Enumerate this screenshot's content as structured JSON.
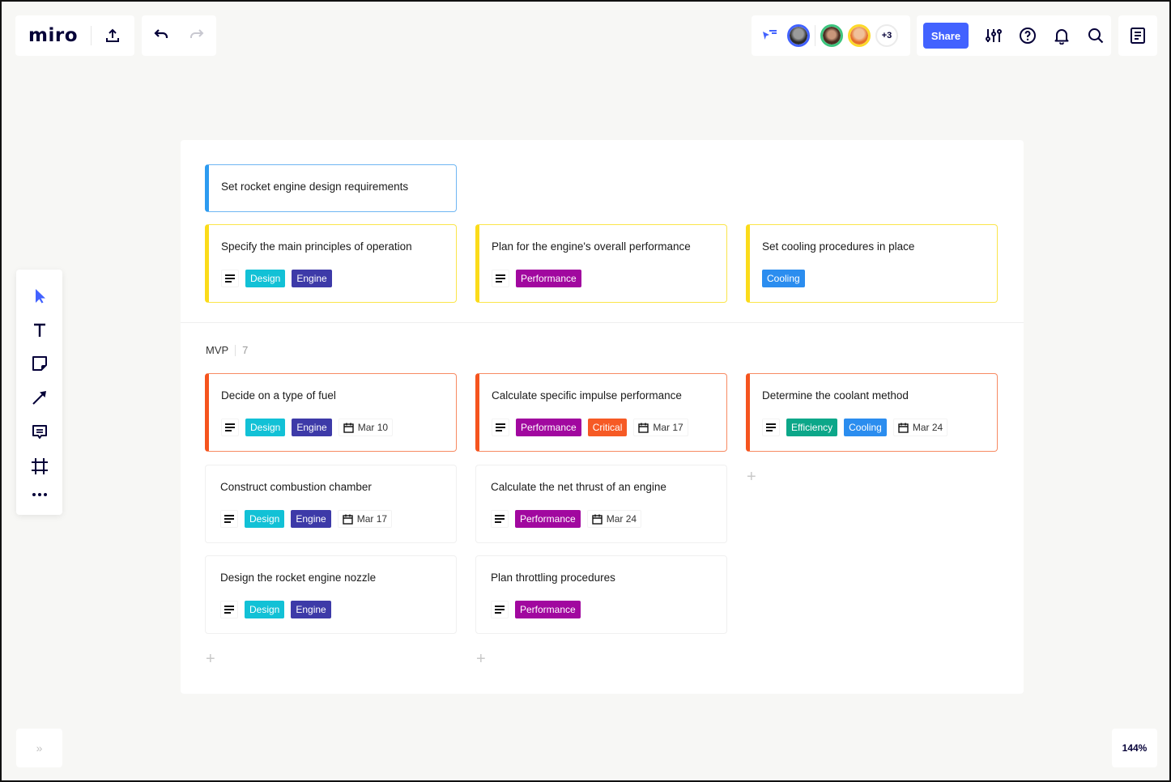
{
  "app": {
    "logo": "miro",
    "zoom_level": "144%",
    "collapse_label": "»"
  },
  "header": {
    "share_label": "Share",
    "collaborators_more": "+3",
    "collaborators": [
      {
        "name": "collaborator-1",
        "ring": "#4262ff",
        "skin": "#6b6b6b"
      },
      {
        "name": "collaborator-2",
        "ring": "#3dc47e",
        "skin": "#8a5a44"
      },
      {
        "name": "collaborator-3",
        "ring": "#fcd92a",
        "skin": "#e0a37a"
      }
    ]
  },
  "colors": {
    "accent_blue": "#4262ff",
    "design": "#12c1d6",
    "engine": "#3d3aa8",
    "performance": "#a1089f",
    "critical": "#f65a25",
    "cooling": "#2b8def",
    "efficiency": "#0ca789",
    "border_blue": "#2d9bf0",
    "border_yellow": "#fbdb1a",
    "border_orange": "#f5541e"
  },
  "board": {
    "top_card": {
      "title": "Set rocket engine design requirements"
    },
    "row1": [
      {
        "title": "Specify the main principles of operation",
        "has_desc": true,
        "tags": [
          {
            "label": "Design",
            "color": "#12c1d6"
          },
          {
            "label": "Engine",
            "color": "#3d3aa8"
          }
        ]
      },
      {
        "title": "Plan for the engine's overall performance",
        "has_desc": true,
        "tags": [
          {
            "label": "Performance",
            "color": "#a1089f"
          }
        ]
      },
      {
        "title": "Set cooling procedures in place",
        "has_desc": false,
        "tags": [
          {
            "label": "Cooling",
            "color": "#2b8def"
          }
        ]
      }
    ],
    "group": {
      "name": "MVP",
      "count": "7"
    },
    "cards": [
      {
        "title": "Decide on a type of fuel",
        "tags": [
          {
            "label": "Design"
          },
          {
            "label": "Engine"
          }
        ],
        "date": "Mar 10"
      },
      {
        "title": "Calculate specific impulse performance",
        "tags": [
          {
            "label": "Performance"
          },
          {
            "label": "Critical"
          }
        ],
        "date": "Mar 17"
      },
      {
        "title": "Determine the coolant method",
        "tags": [
          {
            "label": "Efficiency"
          },
          {
            "label": "Cooling"
          }
        ],
        "date": "Mar 24"
      },
      {
        "title": "Construct combustion chamber",
        "tags": [
          {
            "label": "Design"
          },
          {
            "label": "Engine"
          }
        ],
        "date": "Mar 17"
      },
      {
        "title": "Calculate the net thrust of an engine",
        "tags": [
          {
            "label": "Performance"
          }
        ],
        "date": "Mar 24"
      },
      {
        "title": "Design the rocket engine nozzle",
        "tags": [
          {
            "label": "Design"
          },
          {
            "label": "Engine"
          }
        ]
      },
      {
        "title": "Plan throttling procedures",
        "tags": [
          {
            "label": "Performance"
          }
        ]
      }
    ],
    "add_label": "+"
  }
}
